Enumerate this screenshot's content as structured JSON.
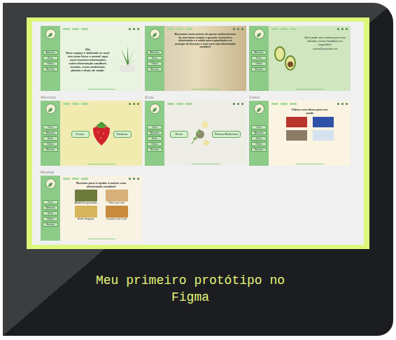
{
  "caption": "Meu primeiro protótipo no Figma",
  "frames": [
    {
      "kind": "intro",
      "nav": [
        "Alimentos",
        "Ervas",
        "Vídeos",
        "Receitas"
      ],
      "greeting": "Olá,",
      "text": "Esse espaço é dedicado se você tem estar físico e mental, aqui você encontra informações sobre alimentação saudável, receitas, ervas medicinais, plantas e dicas de saúde."
    },
    {
      "kind": "about",
      "nav": [
        "Alimentos",
        "Ervas",
        "Vídeos",
        "Receitas"
      ],
      "text": "Buscamos muito através de passar conhecimentos de uma forma simples e gratuita, incentivar a alimentação e a saúde para a população a se proteger de doenças e viver com uma alimentação saudável."
    },
    {
      "kind": "contact",
      "nav": [
        "Alimentos",
        "Ervas",
        "Vídeos",
        "Receitas"
      ],
      "text": "Você pode nos contatar para tirar dúvidas, enviar feedback ou sugestões!",
      "email": "contato@sejasaude.com"
    },
    {
      "kind": "choices",
      "label": "Alimentos",
      "nav": [
        "Início",
        "Alimentos",
        "Ervas",
        "Vídeos",
        "Receitas"
      ],
      "buttons": [
        "Frutas",
        "Verduras"
      ]
    },
    {
      "kind": "choices",
      "label": "Ervas",
      "nav": [
        "Início",
        "Alimentos",
        "Ervas",
        "Vídeos",
        "Receitas"
      ],
      "buttons": [
        "Ervas",
        "Plantas Medicinais"
      ]
    },
    {
      "kind": "videos",
      "label": "Vídeos",
      "nav": [
        "Início",
        "Alimentos",
        "Ervas",
        "Vídeos",
        "Receitas"
      ],
      "title": "Vídeos com dicas para sua saúde",
      "thumbnails": [
        {
          "color": "#b8352b"
        },
        {
          "color": "#2f52a8"
        },
        {
          "color": "#8c7c66"
        },
        {
          "color": "#d6e2ef"
        }
      ]
    },
    {
      "kind": "recipes",
      "label": "Receitas",
      "nav": [
        "Início",
        "Alimentos",
        "Ervas",
        "Vídeos",
        "Receitas"
      ],
      "title": "Receitas para te ajudar a manter uma alimentação saudável",
      "recipes": [
        {
          "name": "Abobrinha gratinada",
          "color": "#6f7b3c"
        },
        {
          "name": "Pão Low Carb",
          "color": "#d8b07a"
        },
        {
          "name": "Muffin Salgado",
          "color": "#d6b45c"
        },
        {
          "name": "Coxinha Low Carb",
          "color": "#c88a3c"
        }
      ]
    }
  ]
}
